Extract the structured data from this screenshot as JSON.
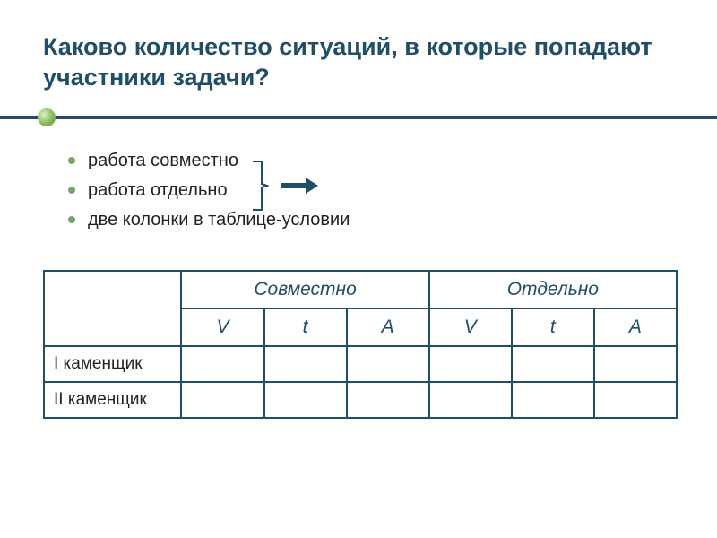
{
  "title": "Каково количество ситуаций, в которые попадают участники задачи?",
  "bullets": {
    "b0": "работа совместно",
    "b1": "работа отдельно",
    "b2": "две колонки в таблице-условии"
  },
  "table": {
    "group1": "Совместно",
    "group2": "Отдельно",
    "cols": {
      "c0": "V",
      "c1": "t",
      "c2": "A",
      "c3": "V",
      "c4": "t",
      "c5": "A"
    },
    "rows": {
      "r0": "I каменщик",
      "r1": "II каменщик"
    }
  }
}
